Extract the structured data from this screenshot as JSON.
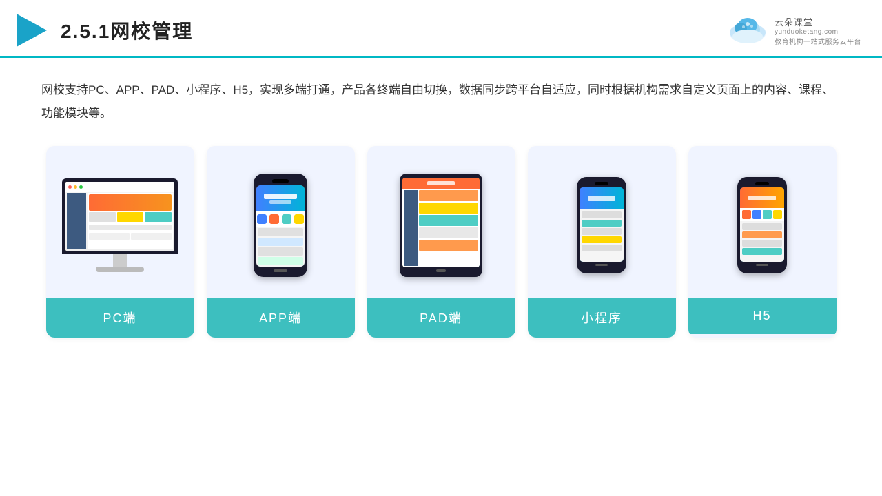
{
  "header": {
    "title": "2.5.1网校管理",
    "title_prefix": "2.5.1",
    "title_main": "网校管理"
  },
  "logo": {
    "name": "云朵课堂",
    "domain": "yunduoketang.com",
    "tagline": "教育机构一站",
    "tagline2": "式服务云平台"
  },
  "description": "网校支持PC、APP、PAD、小程序、H5，实现多端打通，产品各终端自由切换，数据同步跨平台自适应，同时根据机构需求自定义页面上的内容、课程、功能模块等。",
  "cards": [
    {
      "id": "pc",
      "label": "PC端"
    },
    {
      "id": "app",
      "label": "APP端"
    },
    {
      "id": "pad",
      "label": "PAD端"
    },
    {
      "id": "miniapp",
      "label": "小程序"
    },
    {
      "id": "h5",
      "label": "H5"
    }
  ],
  "accent_color": "#3dbfbf"
}
